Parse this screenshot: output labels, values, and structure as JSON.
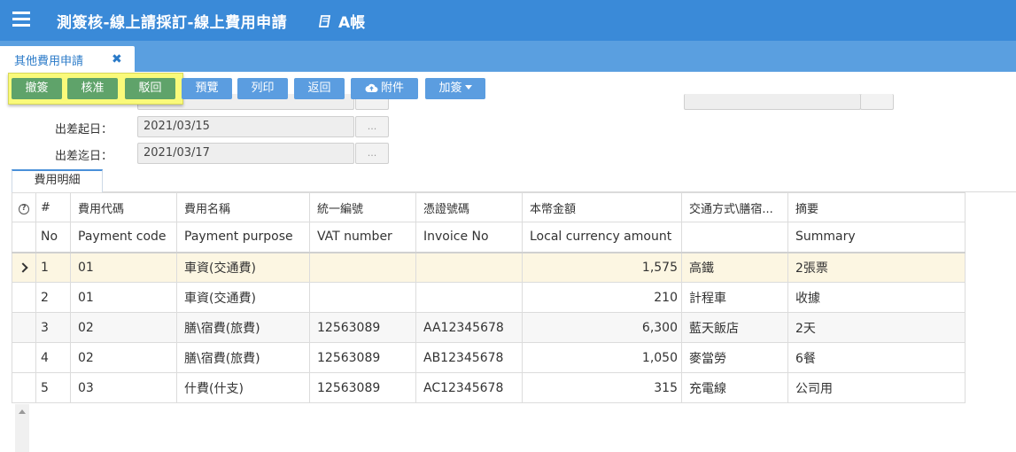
{
  "header": {
    "title": "測簽核-線上請採訂-線上費用申請",
    "ledger": "A帳"
  },
  "tabs": [
    {
      "label": "其他費用申請",
      "close": "✖"
    }
  ],
  "toolbar": {
    "buttons": [
      "撤簽",
      "核准",
      "駁回",
      "預覽",
      "列印",
      "返回",
      "附件",
      "加簽"
    ]
  },
  "form": {
    "start_label": "出差起日：",
    "start_value": "2021/03/15",
    "end_label": "出差迄日：",
    "end_value": "2021/03/17",
    "dots": "..."
  },
  "detail_tab": "費用明細",
  "grid": {
    "help": "?",
    "headers_zh": [
      "#",
      "費用代碼",
      "費用名稱",
      "統一編號",
      "憑證號碼",
      "本幣金額",
      "交通方式\\膳宿...",
      "摘要"
    ],
    "headers_en": [
      "No",
      "Payment code",
      "Payment purpose",
      "VAT number",
      "Invoice No",
      "Local currency amount",
      "",
      "Summary"
    ],
    "rows": [
      {
        "no": "1",
        "code": "01",
        "purpose": "車資(交通費)",
        "vat": "",
        "invoice": "",
        "amount": "1,575",
        "transport": "高鐵",
        "summary": "2張票"
      },
      {
        "no": "2",
        "code": "01",
        "purpose": "車資(交通費)",
        "vat": "",
        "invoice": "",
        "amount": "210",
        "transport": "計程車",
        "summary": "收據"
      },
      {
        "no": "3",
        "code": "02",
        "purpose": "膳\\宿費(旅費)",
        "vat": "12563089",
        "invoice": "AA12345678",
        "amount": "6,300",
        "transport": "藍天飯店",
        "summary": "2天"
      },
      {
        "no": "4",
        "code": "02",
        "purpose": "膳\\宿費(旅費)",
        "vat": "12563089",
        "invoice": "AB12345678",
        "amount": "1,050",
        "transport": "麥當勞",
        "summary": "6餐"
      },
      {
        "no": "5",
        "code": "03",
        "purpose": "什費(什支)",
        "vat": "12563089",
        "invoice": "AC12345678",
        "amount": "315",
        "transport": "充電線",
        "summary": "公司用"
      }
    ],
    "selected_row": 1
  },
  "colors": {
    "header_bg": "#3a8ad8",
    "tabstrip_bg": "#5a9fe0",
    "approve_green": "#5fa36a",
    "action_blue": "#5b9de0",
    "highlight_yellow": "#fafa7a",
    "selected_row": "#fcf6e2"
  },
  "icons": [
    "menu-icon",
    "book-icon",
    "close-icon",
    "cloud-upload-icon",
    "caret-down-icon",
    "help-icon",
    "row-pointer-icon",
    "scroll-up-icon"
  ]
}
